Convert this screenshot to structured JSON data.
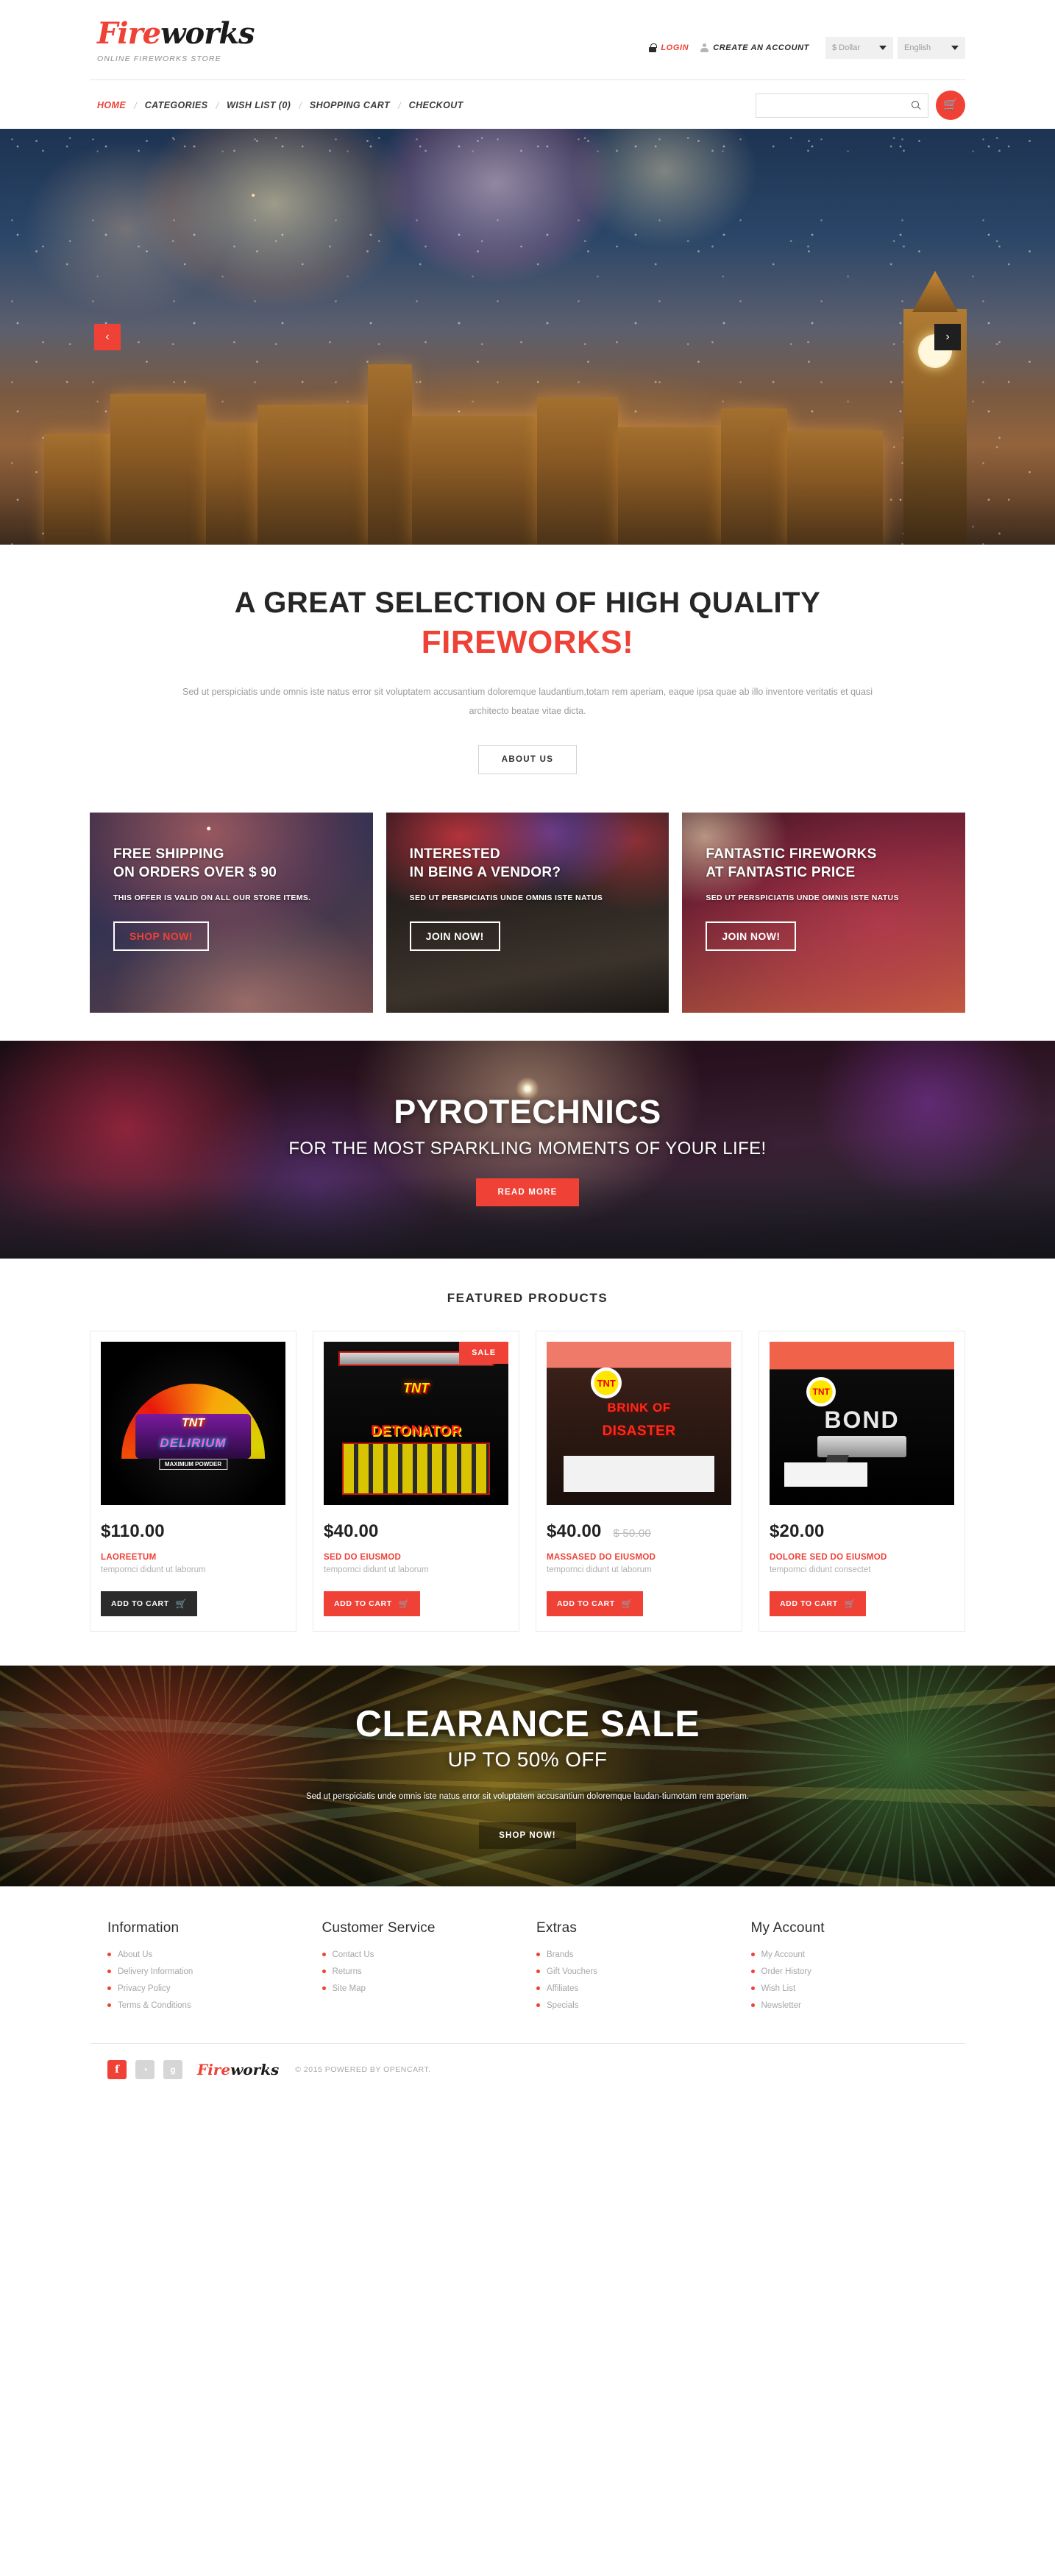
{
  "header": {
    "logo_fire": "Fire",
    "logo_works": "works",
    "tagline": "ONLINE FIREWORKS STORE",
    "login_label": "LOGIN",
    "create_account_label": "CREATE AN ACCOUNT",
    "currency": "$ Dollar",
    "language": "English"
  },
  "nav": {
    "items": [
      {
        "label": "HOME",
        "active": true
      },
      {
        "label": "CATEGORIES",
        "active": false
      },
      {
        "label": "WISH LIST (0)",
        "active": false
      },
      {
        "label": "SHOPPING CART",
        "active": false
      },
      {
        "label": "CHECKOUT",
        "active": false
      }
    ],
    "search_placeholder": "",
    "search_value": ""
  },
  "hero": {
    "prev": "‹",
    "next": "›"
  },
  "intro": {
    "title_line1": "A GREAT SELECTION OF HIGH QUALITY",
    "title_line2": "FIREWORKS!",
    "paragraph": "Sed ut perspiciatis unde omnis iste natus error sit voluptatem accusantium doloremque laudantium,totam rem aperiam, eaque ipsa quae ab illo inventore veritatis et quasi architecto beatae vitae dicta.",
    "button": "ABOUT US"
  },
  "promos": [
    {
      "title_line1": "FREE SHIPPING",
      "title_line2": "ON ORDERS OVER $ 90",
      "subtitle": "THIS OFFER IS VALID ON ALL OUR STORE ITEMS.",
      "cta": "SHOP NOW!",
      "cta_color": "red"
    },
    {
      "title_line1": "INTERESTED",
      "title_line2": "IN BEING A VENDOR?",
      "subtitle": "SED UT PERSPICIATIS UNDE OMNIS ISTE NATUS",
      "cta": "JOIN NOW!",
      "cta_color": "white"
    },
    {
      "title_line1": "FANTASTIC FIREWORKS",
      "title_line2": "AT FANTASTIC PRICE",
      "subtitle": "SED UT PERSPICIATIS UNDE OMNIS ISTE NATUS",
      "cta": "JOIN NOW!",
      "cta_color": "white"
    }
  ],
  "parallax": {
    "title": "PYROTECHNICS",
    "tagline": "FOR THE MOST SPARKLING MOMENTS OF YOUR LIFE!",
    "button": "READ MORE"
  },
  "featured": {
    "title": "FEATURED PRODUCTS",
    "products": [
      {
        "price": "$110.00",
        "old_price": "",
        "name": "LAOREETUM",
        "desc": "tempornci didunt ut laborum",
        "button": "ADD TO CART",
        "badge": "",
        "button_style": "dark",
        "art_tnt": "TNT",
        "art_name": "DELIRIUM",
        "art_note": "MAXIMUM POWDER"
      },
      {
        "price": "$40.00",
        "old_price": "",
        "name": "SED DO EIUSMOD",
        "desc": "tempornci didunt ut laborum",
        "button": "ADD TO CART",
        "badge": "SALE",
        "button_style": "red",
        "art_tnt": "TNT",
        "art_name": "DETONATOR",
        "art_note": ""
      },
      {
        "price": "$40.00",
        "old_price": "$ 50.00",
        "name": "MASSASED DO EIUSMOD",
        "desc": "tempornci didunt ut laborum",
        "button": "ADD TO CART",
        "badge": "",
        "button_style": "red",
        "art_tnt": "TNT",
        "art_name": "BRINK OF",
        "art_note": "DISASTER"
      },
      {
        "price": "$20.00",
        "old_price": "",
        "name": "DOLORE SED DO EIUSMOD",
        "desc": "tempornci didunt consectet",
        "button": "ADD TO CART",
        "badge": "",
        "button_style": "red",
        "art_tnt": "TNT",
        "art_name": "BOND",
        "art_note": ""
      }
    ]
  },
  "clearance": {
    "title": "CLEARANCE SALE",
    "subtitle": "UP TO 50% OFF",
    "paragraph": "Sed ut perspiciatis unde omnis iste natus error sit voluptatem accusantium doloremque laudan-tiumotam rem aperiam.",
    "button": "SHOP NOW!"
  },
  "footer": {
    "columns": [
      {
        "title": "Information",
        "links": [
          "About Us",
          "Delivery Information",
          "Privacy Policy",
          "Terms & Conditions"
        ]
      },
      {
        "title": "Customer Service",
        "links": [
          "Contact Us",
          "Returns",
          "Site Map"
        ]
      },
      {
        "title": "Extras",
        "links": [
          "Brands",
          "Gift Vouchers",
          "Affiliates",
          "Specials"
        ]
      },
      {
        "title": "My Account",
        "links": [
          "My Account",
          "Order History",
          "Wish List",
          "Newsletter"
        ]
      }
    ],
    "social": [
      {
        "name": "facebook",
        "glyph": "f"
      },
      {
        "name": "rss",
        "glyph": "◔"
      },
      {
        "name": "google-plus",
        "glyph": "g"
      }
    ],
    "logo_fire": "Fire",
    "logo_works": "works",
    "copyright": "© 2015 POWERED BY OPENCART."
  },
  "colors": {
    "accent": "#ef4136",
    "dark": "#2b2b2b",
    "muted": "#a6a6a6"
  }
}
